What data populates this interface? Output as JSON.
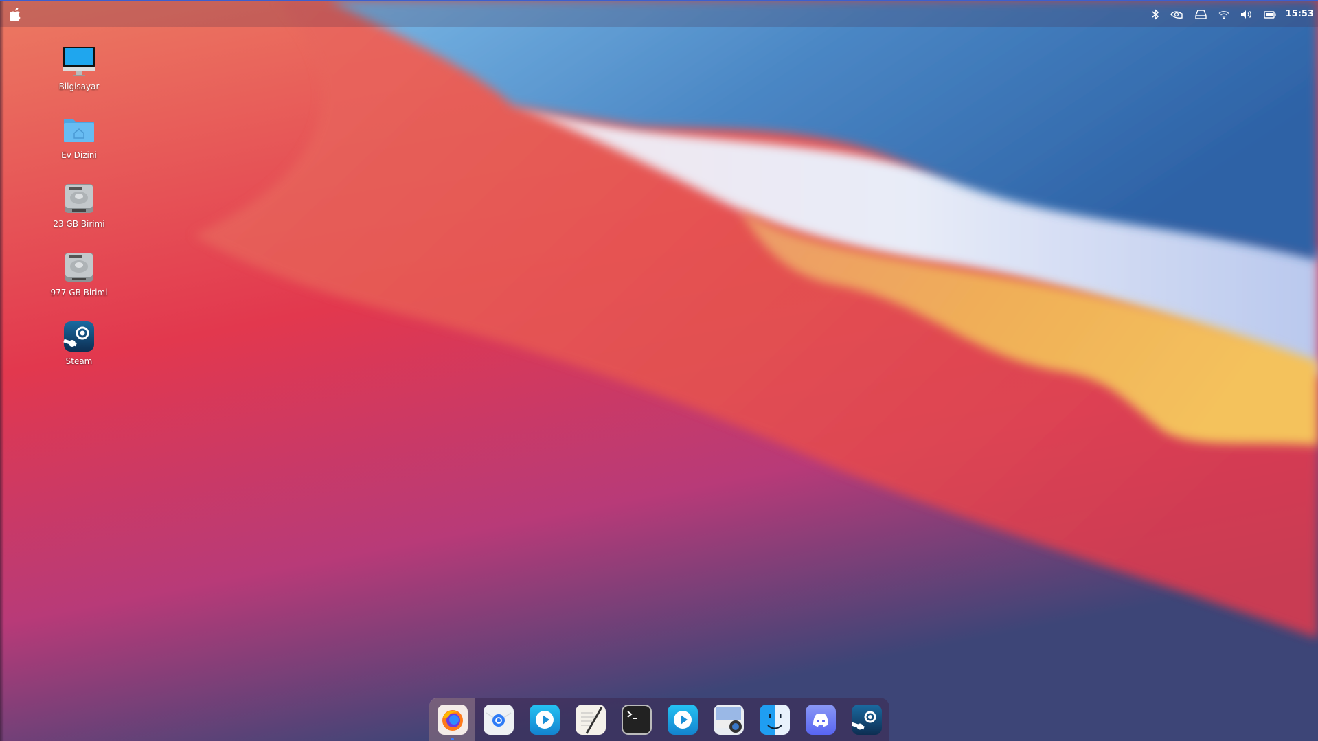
{
  "menubar": {
    "apple_menu": "apple-logo",
    "tray": [
      "bluetooth",
      "nvidia",
      "drive",
      "wifi",
      "volume",
      "battery"
    ],
    "clock": "15:53"
  },
  "desktop": {
    "icons": [
      {
        "label": "Bilgisayar",
        "icon": "computer"
      },
      {
        "label": "Ev Dizini",
        "icon": "home-folder"
      },
      {
        "label": "23 GB Birimi",
        "icon": "hard-drive"
      },
      {
        "label": "977 GB Birimi",
        "icon": "hard-drive"
      },
      {
        "label": "Steam",
        "icon": "steam"
      }
    ]
  },
  "dock": {
    "apps": [
      "Firefox",
      "Mail",
      "Media Player",
      "Text Editor",
      "Terminal",
      "Video Player",
      "Screenshot",
      "Finder",
      "Discord",
      "Steam"
    ],
    "active": "Firefox"
  },
  "colors": {
    "accent": "#3b5fd0"
  }
}
